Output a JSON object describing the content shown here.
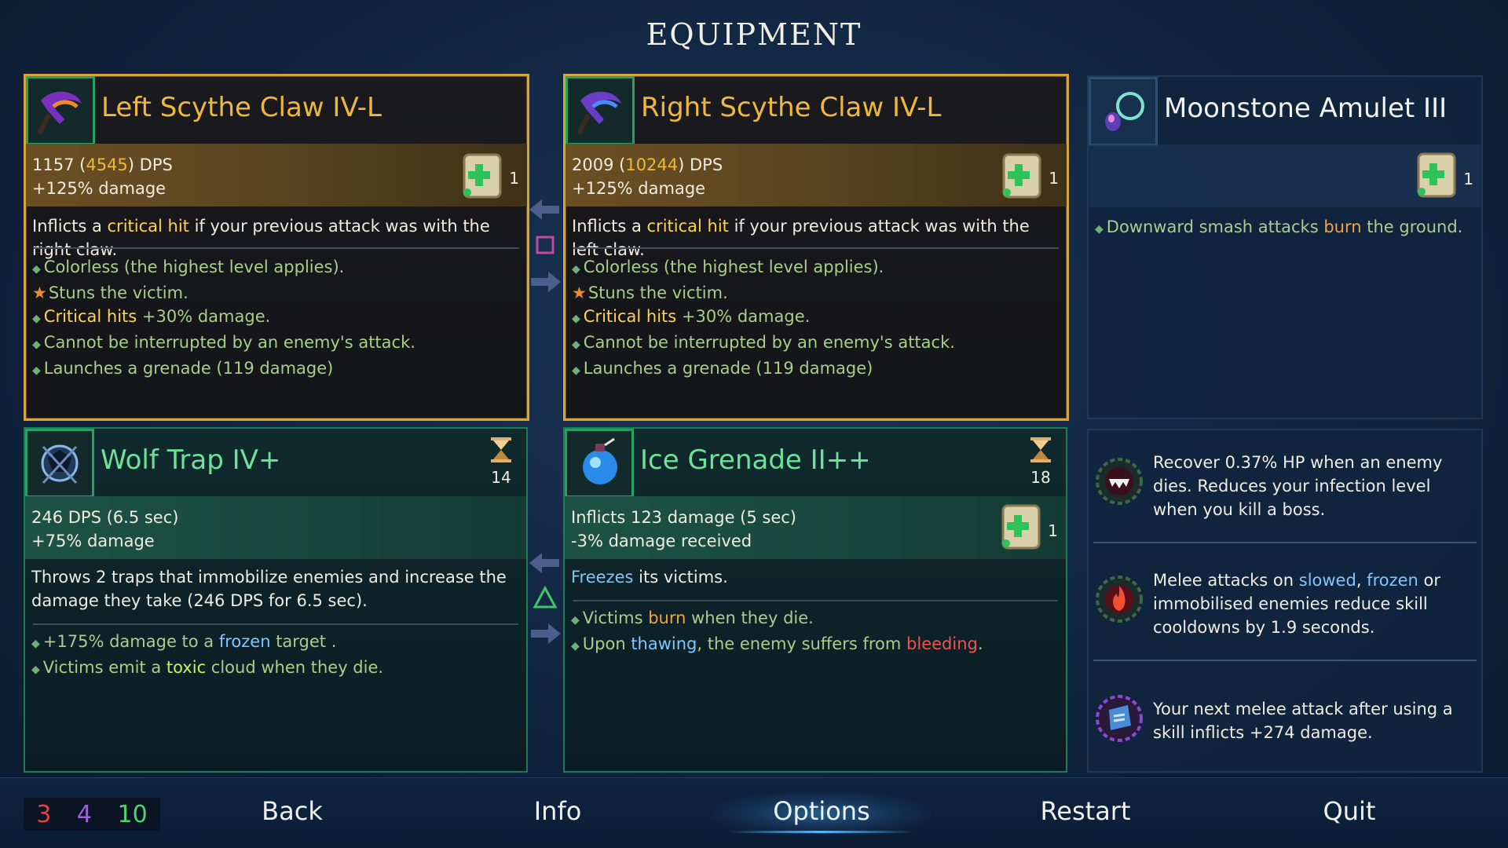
{
  "header": {
    "title": "EQUIPMENT"
  },
  "weapons": [
    {
      "name": "Left Scythe Claw IV-L",
      "dps_base": "1157",
      "dps_paren": "4545",
      "dps_label": "DPS",
      "damage_bonus": "+125% damage",
      "scroll_count": "1",
      "desc_a": "Inflicts a ",
      "desc_hl": "critical hit",
      "desc_b": " if your previous attack was with the right claw.",
      "bullets": [
        "Colorless (the highest level applies).",
        "Stuns the victim.",
        "Critical hits",
        " +30% damage.",
        "Cannot be interrupted by an enemy's attack.",
        "Launches a grenade (119 damage)"
      ]
    },
    {
      "name": "Right Scythe Claw IV-L",
      "dps_base": "2009",
      "dps_paren": "10244",
      "dps_label": "DPS",
      "damage_bonus": "+125% damage",
      "scroll_count": "1",
      "desc_a": "Inflicts a ",
      "desc_hl": "critical hit",
      "desc_b": " if your previous attack was with the left claw.",
      "bullets": [
        "Colorless (the highest level applies).",
        "Stuns the victim.",
        "Critical hits",
        " +30% damage.",
        "Cannot be interrupted by an enemy's attack.",
        "Launches a grenade (119 damage)"
      ]
    }
  ],
  "amulet": {
    "name": "Moonstone Amulet III",
    "scroll_count": "1",
    "bullet_a": "Downward smash attacks ",
    "bullet_hl": "burn",
    "bullet_b": " the ground."
  },
  "skills": [
    {
      "name": "Wolf Trap IV+",
      "cooldown": "14",
      "line1": "246 DPS (6.5 sec)",
      "line2": "+75% damage",
      "desc": "Throws 2 traps that immobilize enemies and increase the damage they take (246 DPS for 6.5 sec).",
      "b1a": "+175% damage to a ",
      "b1hl": "frozen",
      "b1b": " target .",
      "b2a": "Victims emit a ",
      "b2hl": "toxic",
      "b2b": " cloud when they die."
    },
    {
      "name": "Ice Grenade II++",
      "cooldown": "18",
      "scroll_count": "1",
      "line1": "Inflicts 123 damage (5 sec)",
      "line2": "-3% damage received",
      "desc_hl": "Freezes",
      "desc_b": " its victims.",
      "b1a": "Victims ",
      "b1hl": "burn",
      "b1b": " when they die.",
      "b2a": "Upon ",
      "b2hl": "thawing",
      "b2b": ", the enemy suffers from ",
      "b2hl2": "bleeding",
      "b2c": "."
    }
  ],
  "mutations": [
    {
      "text": "Recover 0.37% HP when an enemy dies. Reduces your infection level when you kill a boss."
    },
    {
      "text_a": "Melee attacks on ",
      "hl1": "slowed",
      "sep": ", ",
      "hl2": "frozen",
      "text_b": " or immobilised enemies reduce skill cooldowns by 1.9 seconds."
    },
    {
      "text": "Your next melee attack after using a skill inflicts +274 damage."
    }
  ],
  "stats": {
    "brutality": "3",
    "tactics": "4",
    "survival": "10",
    "colors": {
      "brutality": "#e8403a",
      "tactics": "#a25ce6",
      "survival": "#4fd36a"
    }
  },
  "menu": {
    "back": "Back",
    "info": "Info",
    "options": "Options",
    "restart": "Restart",
    "quit": "Quit"
  },
  "icons": {
    "left_weapon": "scythe-claw-icon",
    "right_weapon": "scythe-claw-icon",
    "amulet": "amulet-icon",
    "skill1": "wolf-trap-icon",
    "skill2": "ice-grenade-icon",
    "scroll": "scroll-icon",
    "cooldown": "hourglass-icon"
  }
}
